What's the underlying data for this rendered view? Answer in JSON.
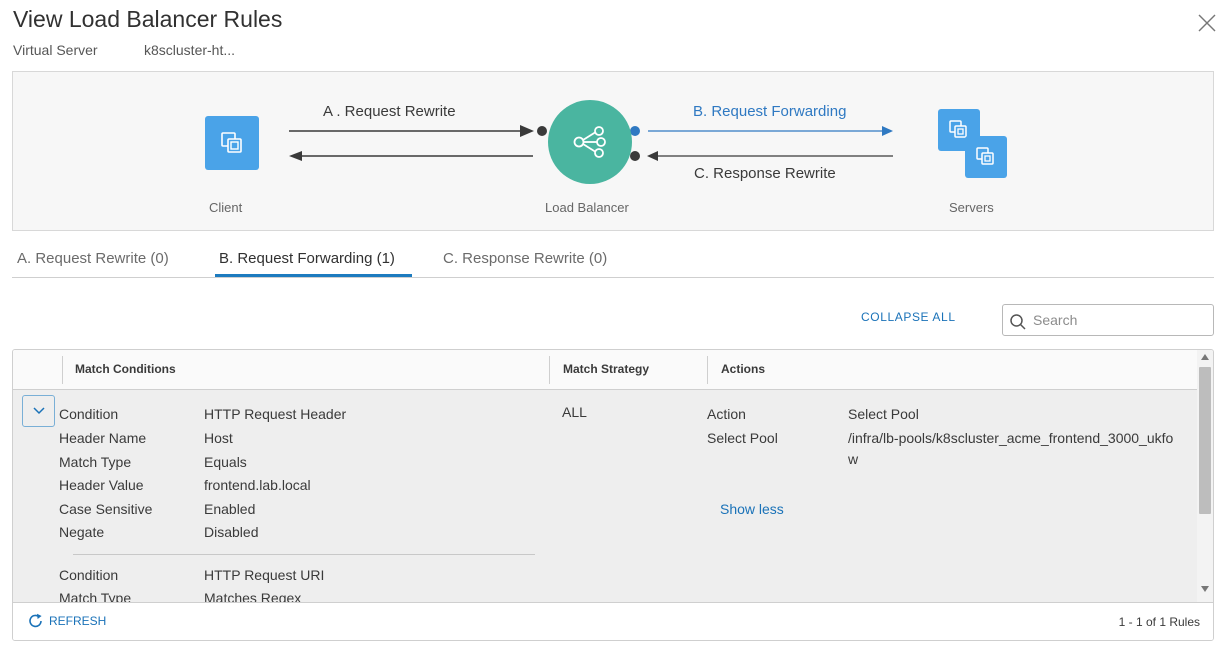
{
  "dialog": {
    "title": "View Load Balancer Rules",
    "virtual_server_label": "Virtual Server",
    "virtual_server_value": "k8scluster-ht..."
  },
  "diagram": {
    "client_label": "Client",
    "lb_label": "Load Balancer",
    "servers_label": "Servers",
    "arrow_a": "A . Request Rewrite",
    "arrow_b": "B. Request Forwarding",
    "arrow_c": "C. Response Rewrite",
    "accent_blue": "#4aa3e8",
    "lb_color": "#4ab5a0"
  },
  "tabs": [
    {
      "label": "A. Request Rewrite (0)",
      "active": false
    },
    {
      "label": "B. Request Forwarding (1)",
      "active": true
    },
    {
      "label": "C. Response Rewrite (0)",
      "active": false
    }
  ],
  "toolbar": {
    "collapse_all": "COLLAPSE ALL",
    "search_placeholder": "Search"
  },
  "grid": {
    "columns": [
      "Match Conditions",
      "Match Strategy",
      "Actions"
    ],
    "row": {
      "conditions": [
        {
          "key": "Condition",
          "value": "HTTP Request Header"
        },
        {
          "key": "Header Name",
          "value": "Host"
        },
        {
          "key": "Match Type",
          "value": "Equals"
        },
        {
          "key": "Header Value",
          "value": "frontend.lab.local"
        },
        {
          "key": "Case Sensitive",
          "value": "Enabled"
        },
        {
          "key": "Negate",
          "value": "Disabled"
        }
      ],
      "conditions_2": [
        {
          "key": "Condition",
          "value": "HTTP Request URI"
        },
        {
          "key": "Match Type",
          "value": "Matches Regex"
        }
      ],
      "match_strategy": "ALL",
      "actions": [
        {
          "key": "Action",
          "value": "Select Pool"
        },
        {
          "key": "Select Pool",
          "value": "/infra/lb-pools/k8scluster_acme_frontend_3000_ukfow"
        }
      ],
      "show_less": "Show less"
    },
    "footer": {
      "refresh": "REFRESH",
      "count": "1 - 1 of 1 Rules"
    }
  }
}
